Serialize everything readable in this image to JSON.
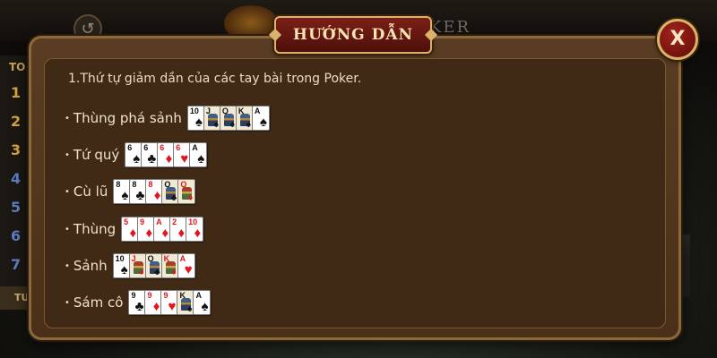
{
  "background": {
    "title": "POKER",
    "leaderboard": {
      "header": "TO",
      "ranks": [
        "1",
        "2",
        "3",
        "4",
        "5",
        "6",
        "7"
      ],
      "footer": "TU"
    }
  },
  "dialog": {
    "title": "HƯỚNG DẪN",
    "close_label": "X",
    "intro": "1.Thứ tự giảm dần của các tay bài trong Poker.",
    "hands": [
      {
        "name": "Thùng phá sảnh",
        "cards": [
          {
            "rank": "10",
            "suit": "♠",
            "color": "black",
            "face": false
          },
          {
            "rank": "J",
            "suit": "♠",
            "color": "black",
            "face": true
          },
          {
            "rank": "Q",
            "suit": "♠",
            "color": "black",
            "face": true
          },
          {
            "rank": "K",
            "suit": "♠",
            "color": "black",
            "face": true
          },
          {
            "rank": "A",
            "suit": "♠",
            "color": "black",
            "face": false
          }
        ]
      },
      {
        "name": "Tứ quý",
        "cards": [
          {
            "rank": "6",
            "suit": "♠",
            "color": "black",
            "face": false
          },
          {
            "rank": "6",
            "suit": "♣",
            "color": "black",
            "face": false
          },
          {
            "rank": "6",
            "suit": "♦",
            "color": "red",
            "face": false
          },
          {
            "rank": "6",
            "suit": "♥",
            "color": "red",
            "face": false
          },
          {
            "rank": "A",
            "suit": "♠",
            "color": "black",
            "face": false
          }
        ]
      },
      {
        "name": "Cù lũ",
        "cards": [
          {
            "rank": "8",
            "suit": "♠",
            "color": "black",
            "face": false
          },
          {
            "rank": "8",
            "suit": "♣",
            "color": "black",
            "face": false
          },
          {
            "rank": "8",
            "suit": "♦",
            "color": "red",
            "face": false
          },
          {
            "rank": "Q",
            "suit": "♣",
            "color": "black",
            "face": true
          },
          {
            "rank": "Q",
            "suit": "♦",
            "color": "red",
            "face": true
          }
        ]
      },
      {
        "name": "Thùng",
        "cards": [
          {
            "rank": "5",
            "suit": "♦",
            "color": "red",
            "face": false
          },
          {
            "rank": "9",
            "suit": "♦",
            "color": "red",
            "face": false
          },
          {
            "rank": "A",
            "suit": "♦",
            "color": "red",
            "face": false
          },
          {
            "rank": "2",
            "suit": "♦",
            "color": "red",
            "face": false
          },
          {
            "rank": "10",
            "suit": "♦",
            "color": "red",
            "face": false
          }
        ]
      },
      {
        "name": "Sảnh",
        "cards": [
          {
            "rank": "10",
            "suit": "♠",
            "color": "black",
            "face": false
          },
          {
            "rank": "J",
            "suit": "♦",
            "color": "red",
            "face": true
          },
          {
            "rank": "Q",
            "suit": "♣",
            "color": "black",
            "face": true
          },
          {
            "rank": "K",
            "suit": "♦",
            "color": "red",
            "face": true
          },
          {
            "rank": "A",
            "suit": "♥",
            "color": "red",
            "face": false
          }
        ]
      },
      {
        "name": "Sám cô",
        "cards": [
          {
            "rank": "9",
            "suit": "♣",
            "color": "black",
            "face": false
          },
          {
            "rank": "9",
            "suit": "♦",
            "color": "red",
            "face": false
          },
          {
            "rank": "9",
            "suit": "♥",
            "color": "red",
            "face": false
          },
          {
            "rank": "K",
            "suit": "♠",
            "color": "black",
            "face": true
          },
          {
            "rank": "A",
            "suit": "♠",
            "color": "black",
            "face": false
          }
        ]
      }
    ]
  },
  "colors": {
    "dialog_bg": "#4a3019",
    "frame_gold": "#d9b36a",
    "title_red": "#7b1f17",
    "text": "#efe3c9",
    "card_red": "#e3151a"
  }
}
